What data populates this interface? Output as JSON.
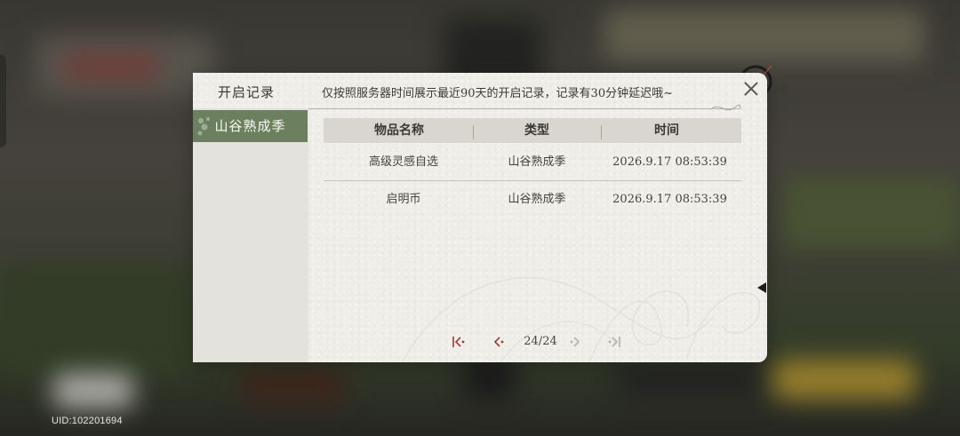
{
  "dialog": {
    "title": "开启记录",
    "notice": "仅按照服务器时间展示最近90天的开启记录，记录有30分钟延迟哦~",
    "close_icon": "close-icon"
  },
  "sidebar": {
    "items": [
      {
        "label": "山谷熟成季",
        "selected": true
      }
    ]
  },
  "table": {
    "headers": [
      "物品名称",
      "类型",
      "时间"
    ],
    "rows": [
      {
        "name": "高级灵感自选",
        "type": "山谷熟成季",
        "time": "2026.9.17 08:53:39"
      },
      {
        "name": "启明币",
        "type": "山谷熟成季",
        "time": "2026.9.17 08:53:39"
      }
    ]
  },
  "pagination": {
    "page_text": "24/24",
    "current_page": 24,
    "total_pages": 24,
    "icons": [
      "first-page-icon",
      "prev-page-icon",
      "next-page-icon",
      "last-page-icon"
    ]
  },
  "footer": {
    "uid": "UID:102201694"
  },
  "colors": {
    "accent_green": "#6c8060",
    "accent_red": "#9c3a3a",
    "paper": "#efede8",
    "disabled_icon": "#b6b1a8"
  }
}
